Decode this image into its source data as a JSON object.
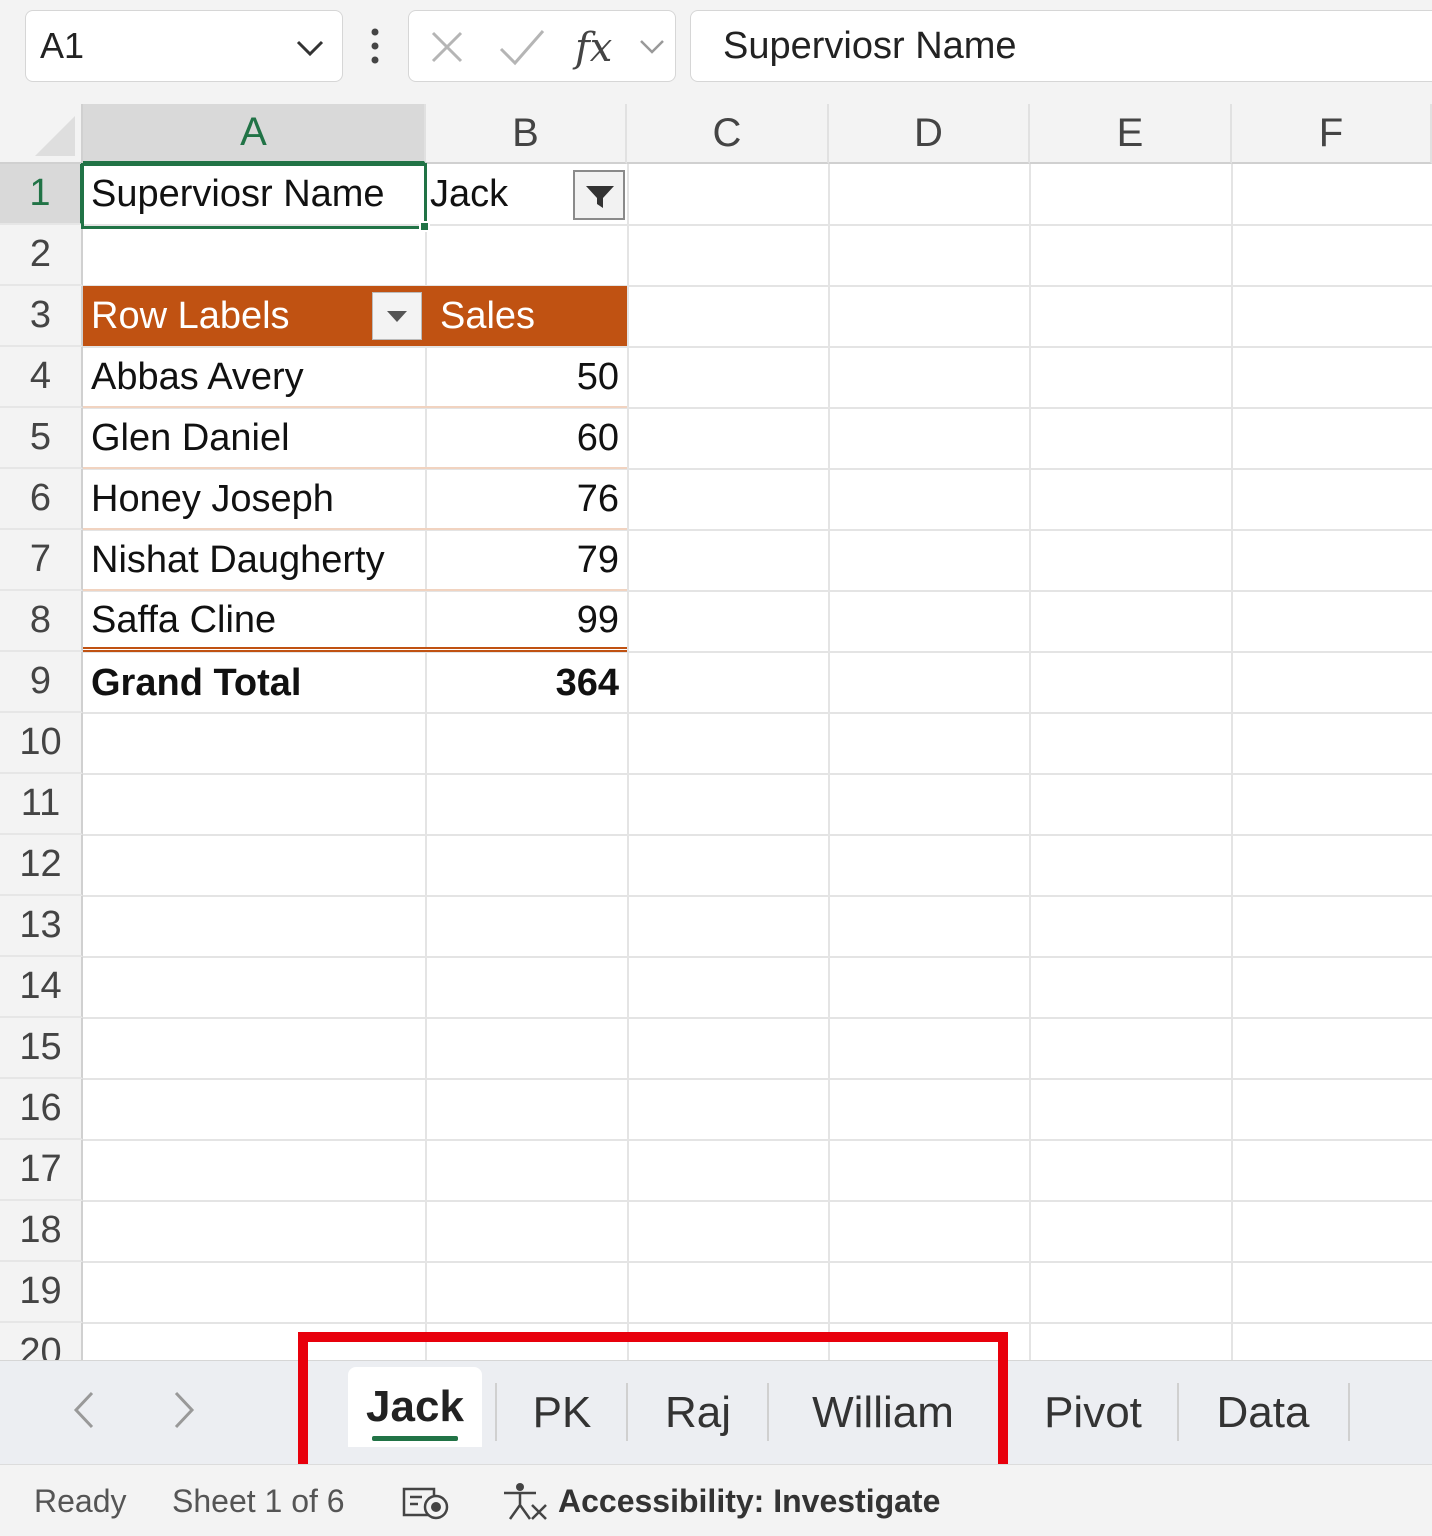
{
  "formula_bar": {
    "name_box": "A1",
    "formula": "Superviosr Name"
  },
  "columns": [
    "A",
    "B",
    "C",
    "D",
    "E",
    "F"
  ],
  "rows": [
    "1",
    "2",
    "3",
    "4",
    "5",
    "6",
    "7",
    "8",
    "9",
    "10",
    "11",
    "12",
    "13",
    "14",
    "15",
    "16",
    "17",
    "18",
    "19",
    "20"
  ],
  "sheet": {
    "a1": "Superviosr Name",
    "b1": "Jack",
    "pivot": {
      "header_row_labels": "Row Labels",
      "header_sales": "Sales",
      "rows": [
        {
          "name": "Abbas Avery",
          "sales": "50"
        },
        {
          "name": "Glen Daniel",
          "sales": "60"
        },
        {
          "name": "Honey Joseph",
          "sales": "76"
        },
        {
          "name": "Nishat Daugherty",
          "sales": "79"
        },
        {
          "name": "Saffa Cline",
          "sales": "99"
        }
      ],
      "total_label": "Grand Total",
      "total_value": "364"
    }
  },
  "tabs": [
    "Jack",
    "PK",
    "Raj",
    "William",
    "Pivot",
    "Data"
  ],
  "active_tab": "Jack",
  "status": {
    "ready": "Ready",
    "sheet_position": "Sheet 1 of 6",
    "accessibility": "Accessibility: Investigate"
  },
  "colors": {
    "accent": "#217346",
    "pivot_header": "#c05212",
    "highlight": "#e8000c"
  }
}
